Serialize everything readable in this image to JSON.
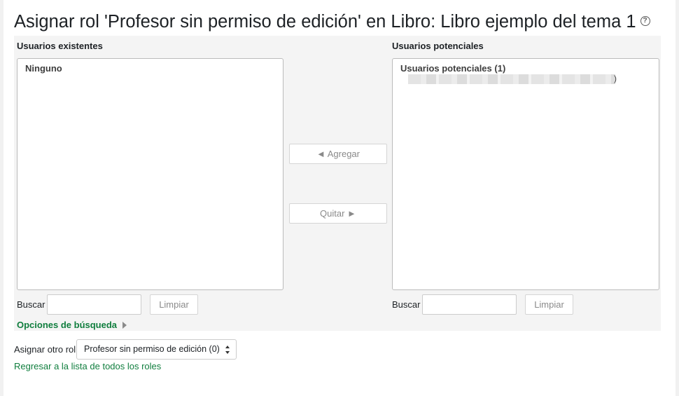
{
  "page": {
    "title": "Asignar rol 'Profesor sin permiso de edición' en Libro: Libro ejemplo del tema 1",
    "help_icon": "question-circle-icon"
  },
  "existing_users": {
    "heading": "Usuarios existentes",
    "group_label": "Ninguno",
    "search_label": "Buscar",
    "search_value": "",
    "clear_label": "Limpiar"
  },
  "potential_users": {
    "heading": "Usuarios potenciales",
    "group_label": "Usuarios potenciales (1)",
    "item_suffix": ")",
    "search_label": "Buscar",
    "search_value": "",
    "clear_label": "Limpiar"
  },
  "actions": {
    "add_label": "◄ Agregar",
    "remove_label": "Quitar ►"
  },
  "search_options": {
    "label": "Opciones de búsqueda",
    "icon": "caret-right-icon"
  },
  "other_role": {
    "label": "Asignar otro rol",
    "selected": "Profesor sin permiso de edición (0)"
  },
  "back_link": "Regresar a la lista de todos los roles",
  "colors": {
    "link": "#107e3e",
    "panel_bg": "#f4f4f4",
    "button_text": "#8a8a8a"
  }
}
